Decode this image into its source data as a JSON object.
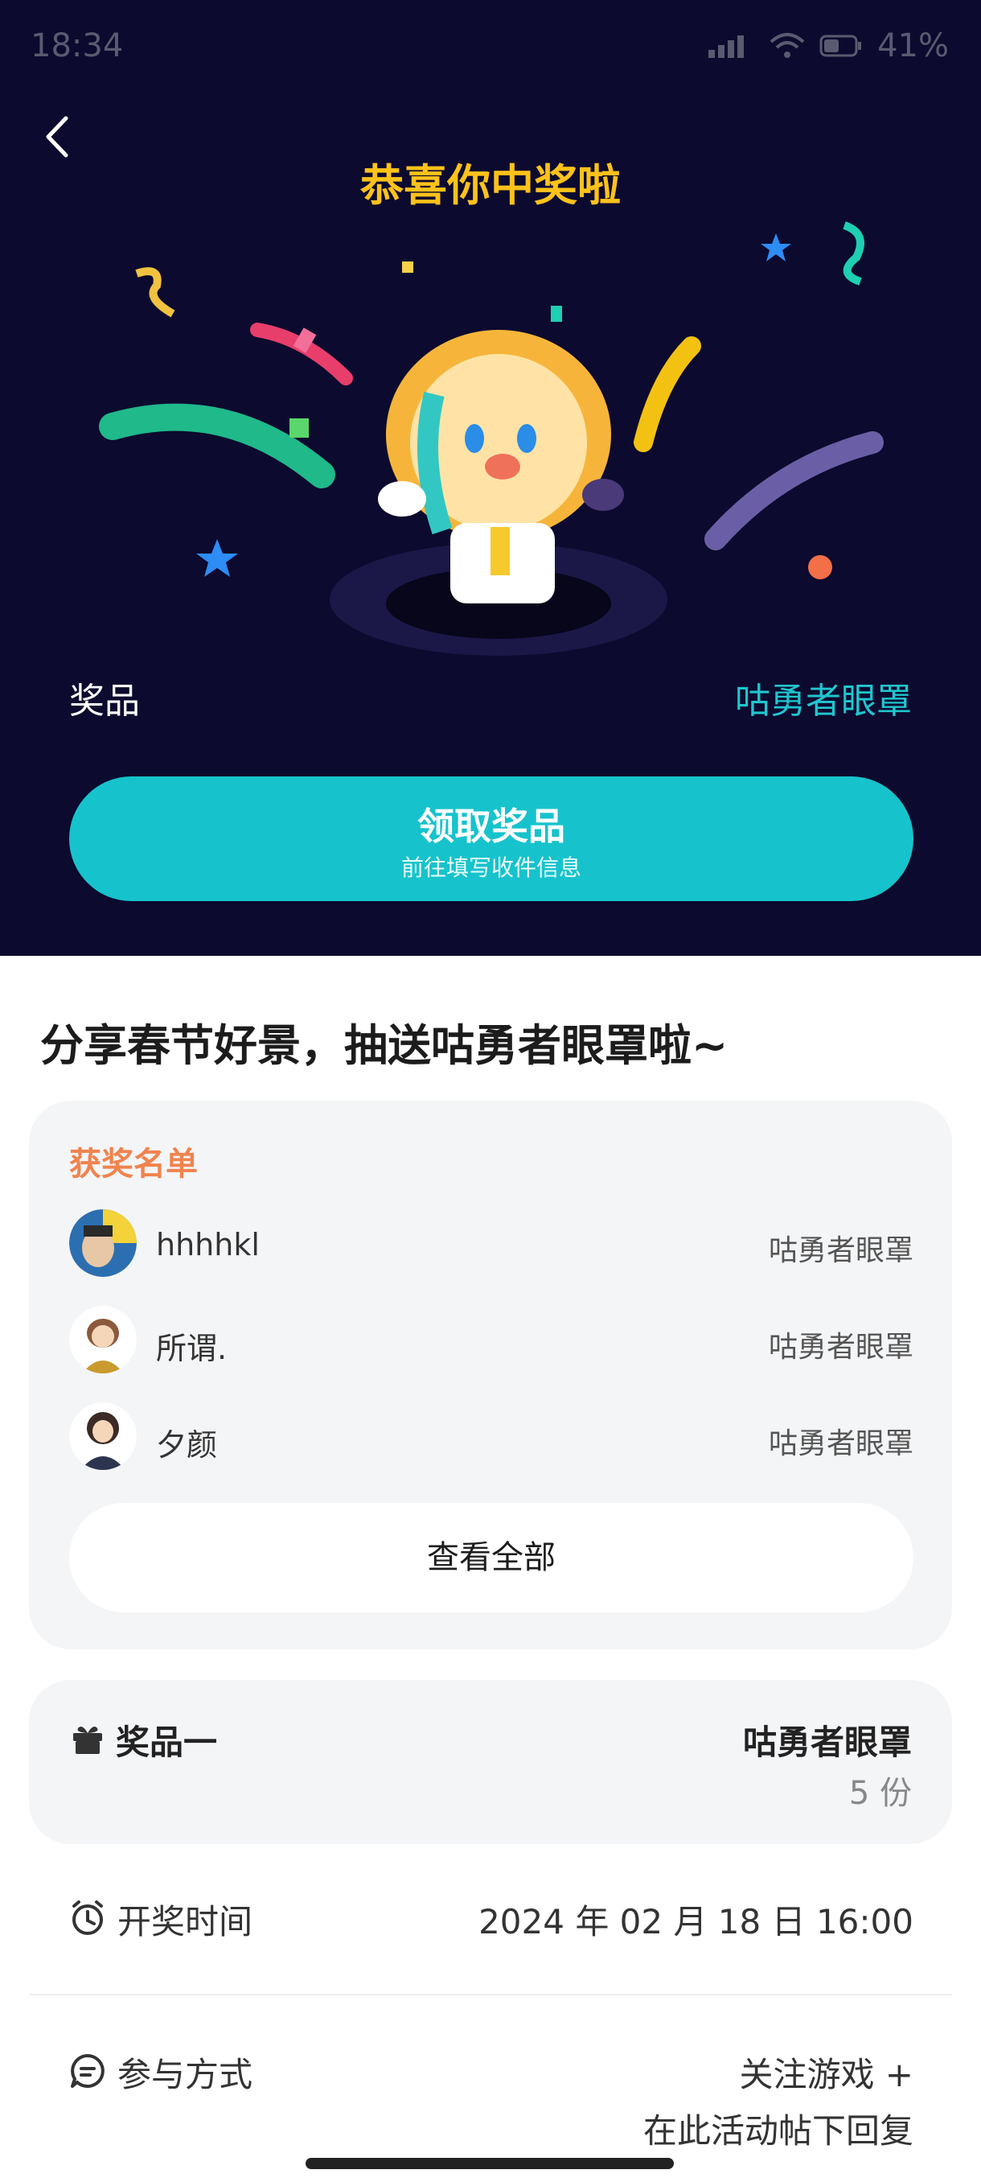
{
  "status": {
    "time": "18:34",
    "battery": "41%"
  },
  "hero": {
    "title": "恭喜你中奖啦",
    "prize_label": "奖品",
    "prize_value": "咕勇者眼罩",
    "claim_button": {
      "label": "领取奖品",
      "sublabel": "前往填写收件信息"
    }
  },
  "activity": {
    "title": "分享春节好景，抽送咕勇者眼罩啦~"
  },
  "winners": {
    "heading": "获奖名单",
    "rows": [
      {
        "name": "hhhhkl",
        "prize": "咕勇者眼罩"
      },
      {
        "name": "所谓.",
        "prize": "咕勇者眼罩"
      },
      {
        "name": "夕颜",
        "prize": "咕勇者眼罩"
      }
    ],
    "view_all": "查看全部"
  },
  "prize_card": {
    "label": "奖品一",
    "name": "咕勇者眼罩",
    "quantity": "5 份"
  },
  "draw_time": {
    "label": "开奖时间",
    "value": "2024 年 02 月 18 日 16:00"
  },
  "participation": {
    "label": "参与方式",
    "line1": "关注游戏 +",
    "line2": "在此活动帖下回复"
  },
  "colors": {
    "hero_bg": "#0c0a2e",
    "accent_teal": "#16c3cc",
    "title_yellow": "#ffc21a",
    "winners_orange": "#f0834e"
  }
}
